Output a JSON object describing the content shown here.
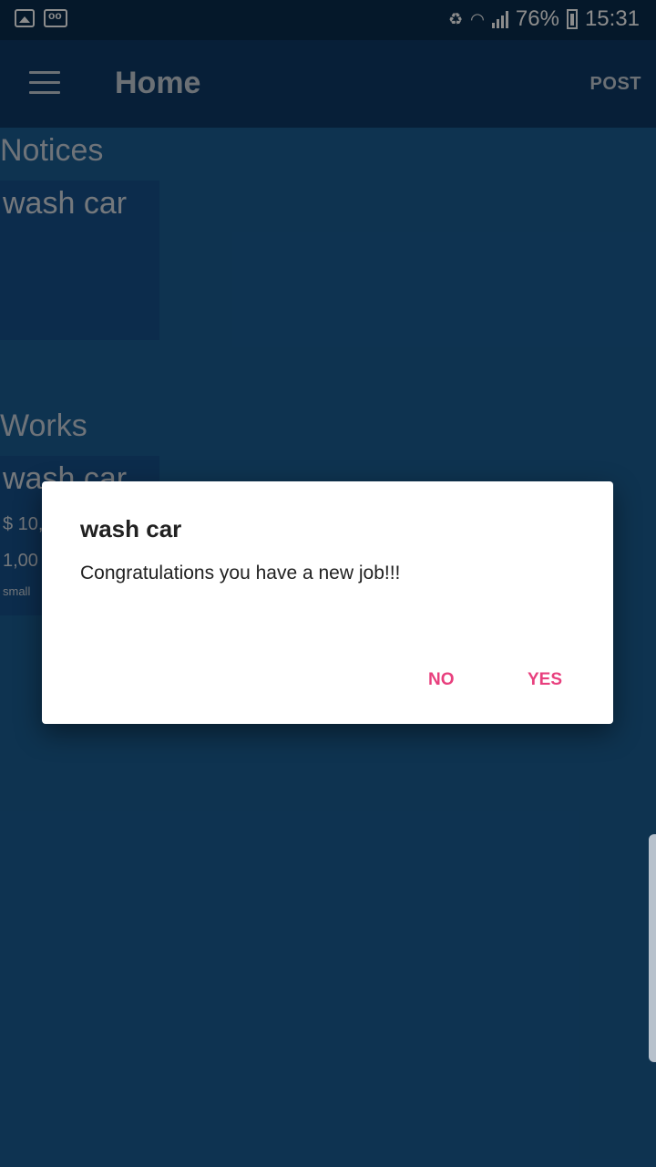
{
  "status_bar": {
    "battery_percent": "76%",
    "time": "15:31",
    "icons": [
      "gallery-icon",
      "voicemail-icon",
      "battery-saver-icon",
      "wifi-icon",
      "signal-icon",
      "battery-icon"
    ]
  },
  "app_bar": {
    "title": "Home",
    "action_label": "POST",
    "menu_icon": "menu-icon"
  },
  "notices": {
    "heading": "Notices",
    "cards": [
      {
        "title": "wash car"
      }
    ]
  },
  "works": {
    "heading": "Works",
    "cards": [
      {
        "title": "wash car",
        "price": "$ 10,",
        "amount": "1,00",
        "size": "small"
      }
    ]
  },
  "dialog": {
    "title": "wash car",
    "message": "Congratulations you have a new job!!!",
    "negative_label": "NO",
    "positive_label": "YES",
    "accent_color": "#e8407e"
  }
}
